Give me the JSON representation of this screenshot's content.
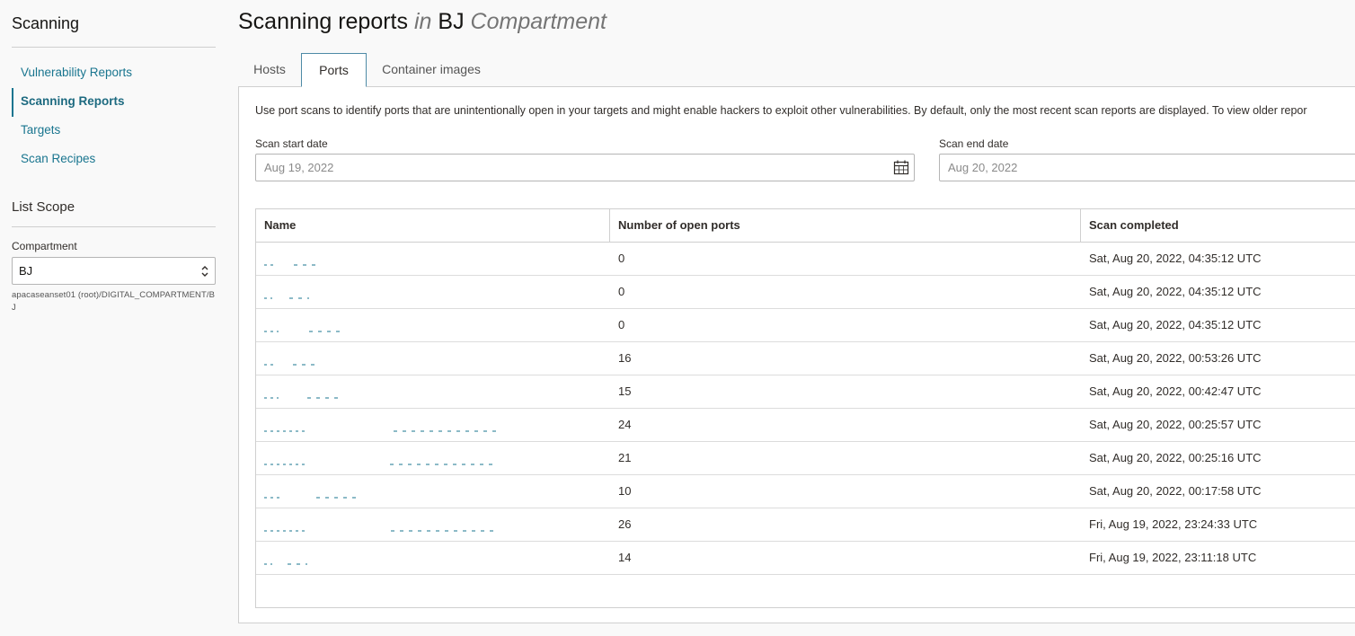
{
  "sidebar": {
    "title": "Scanning",
    "items": [
      {
        "label": "Vulnerability Reports"
      },
      {
        "label": "Scanning Reports"
      },
      {
        "label": "Targets"
      },
      {
        "label": "Scan Recipes"
      }
    ],
    "scope_title": "List Scope",
    "compartment_label": "Compartment",
    "compartment_value": "BJ",
    "compartment_path": "apacaseanset01 (root)/DIGITAL_COMPARTMENT/BJ"
  },
  "header": {
    "title": "Scanning reports",
    "in_word": "in",
    "compartment": "BJ",
    "compartment_suffix": "Compartment"
  },
  "tabs": [
    {
      "label": "Hosts"
    },
    {
      "label": "Ports"
    },
    {
      "label": "Container images"
    }
  ],
  "panel": {
    "description": "Use port scans to identify ports that are unintentionally open in your targets and might enable hackers to exploit other vulnerabilities. By default, only the most recent scan reports are displayed. To view older repor",
    "start_label": "Scan start date",
    "start_value": "Aug 19, 2022",
    "end_label": "Scan end date",
    "end_value": "Aug 20, 2022"
  },
  "table": {
    "headers": [
      "Name",
      "Number of open ports",
      "Scan completed"
    ],
    "rows": [
      {
        "ports": "0",
        "completed": "Sat, Aug 20, 2022, 04:35:12 UTC"
      },
      {
        "ports": "0",
        "completed": "Sat, Aug 20, 2022, 04:35:12 UTC"
      },
      {
        "ports": "0",
        "completed": "Sat, Aug 20, 2022, 04:35:12 UTC"
      },
      {
        "ports": "16",
        "completed": "Sat, Aug 20, 2022, 00:53:26 UTC"
      },
      {
        "ports": "15",
        "completed": "Sat, Aug 20, 2022, 00:42:47 UTC"
      },
      {
        "ports": "24",
        "completed": "Sat, Aug 20, 2022, 00:25:57 UTC"
      },
      {
        "ports": "21",
        "completed": "Sat, Aug 20, 2022, 00:25:16 UTC"
      },
      {
        "ports": "10",
        "completed": "Sat, Aug 20, 2022, 00:17:58 UTC"
      },
      {
        "ports": "26",
        "completed": "Fri, Aug 19, 2022, 23:24:33 UTC"
      },
      {
        "ports": "14",
        "completed": "Fri, Aug 19, 2022, 23:11:18 UTC"
      }
    ]
  },
  "colors": {
    "link": "#19758f",
    "accent_border": "#4e8aa6"
  }
}
